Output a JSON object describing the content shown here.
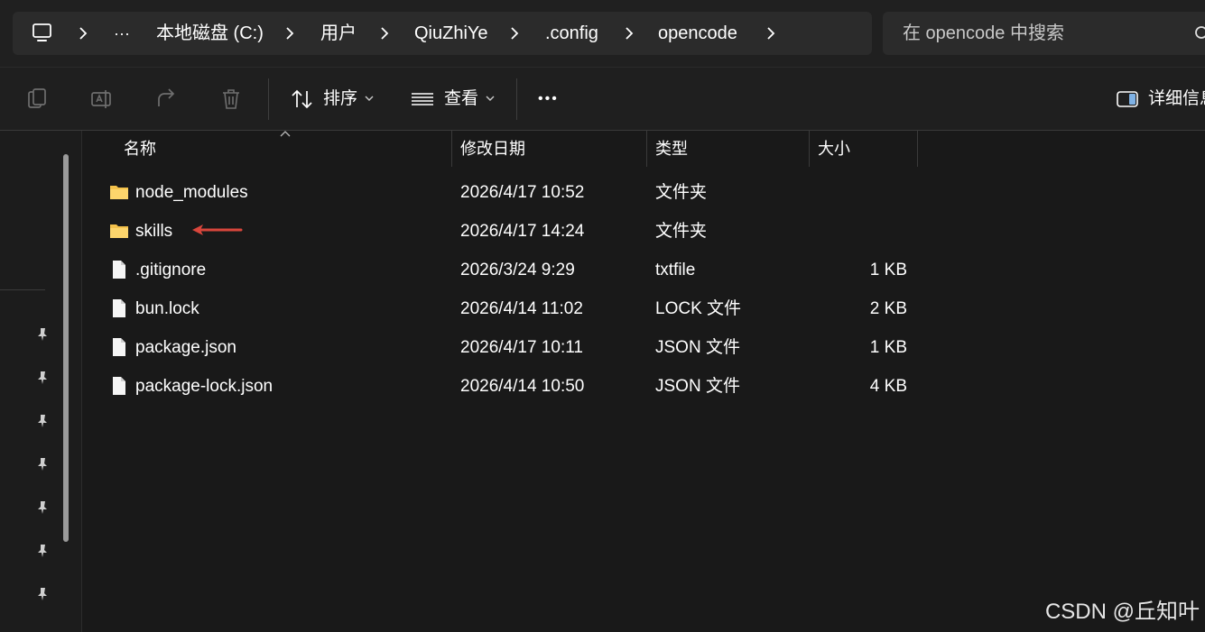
{
  "address_bar": {
    "overflow_label": "···",
    "crumbs": [
      "本地磁盘 (C:)",
      "用户",
      "QiuZhiYe",
      ".config",
      "opencode"
    ]
  },
  "search": {
    "placeholder": "在 opencode 中搜索"
  },
  "toolbar": {
    "sort_label": "排序",
    "view_label": "查看",
    "more_label": "•••",
    "details_label": "详细信息"
  },
  "columns": {
    "name": "名称",
    "modified": "修改日期",
    "type": "类型",
    "size": "大小"
  },
  "files": [
    {
      "name": "node_modules",
      "modified": "2026/4/17 10:52",
      "type": "文件夹",
      "size": "",
      "icon": "folder-icon"
    },
    {
      "name": "skills",
      "modified": "2026/4/17 14:24",
      "type": "文件夹",
      "size": "",
      "icon": "folder-icon"
    },
    {
      "name": ".gitignore",
      "modified": "2026/3/24 9:29",
      "type": "txtfile",
      "size": "1 KB",
      "icon": "file-icon"
    },
    {
      "name": "bun.lock",
      "modified": "2026/4/14 11:02",
      "type": "LOCK 文件",
      "size": "2 KB",
      "icon": "file-icon"
    },
    {
      "name": "package.json",
      "modified": "2026/4/17 10:11",
      "type": "JSON 文件",
      "size": "1 KB",
      "icon": "file-icon"
    },
    {
      "name": "package-lock.json",
      "modified": "2026/4/14 10:50",
      "type": "JSON 文件",
      "size": "4 KB",
      "icon": "file-icon"
    }
  ],
  "watermark": "CSDN @丘知叶",
  "colors": {
    "background": "#191919",
    "folder": "#f3c14b",
    "arrow": "#d9463c",
    "text": "#ffffff"
  }
}
